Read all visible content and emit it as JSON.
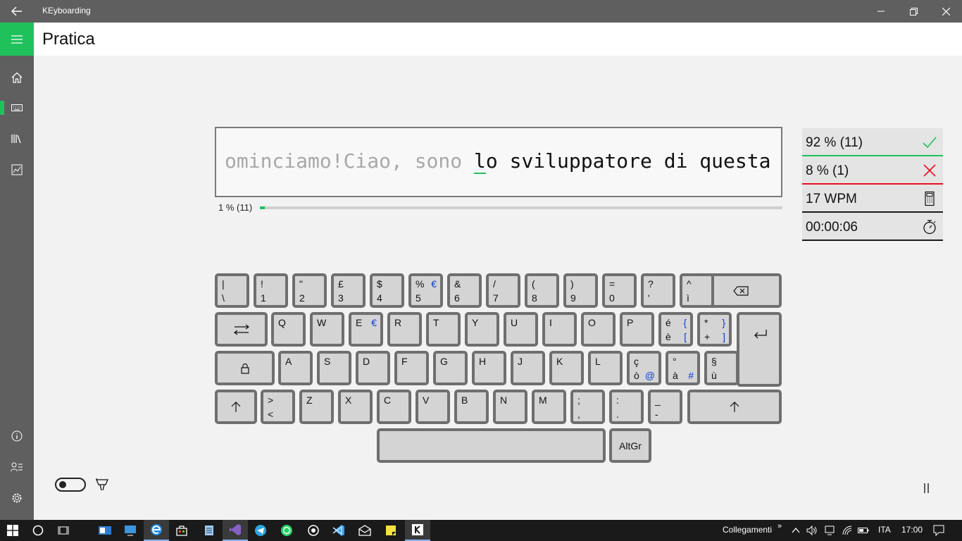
{
  "window": {
    "title": "KEyboarding"
  },
  "header": {
    "title": "Pratica"
  },
  "exercise": {
    "typed": "ominciamo!Ciao, sono ",
    "current": "l",
    "remaining": "o sviluppatore di questa app",
    "progress_text": "1 % (11)",
    "progress_fraction": 0.01
  },
  "stats": {
    "correct": "92 % (11)",
    "errors": "8 % (1)",
    "speed": "17 WPM",
    "time": "00:00:06"
  },
  "keyboard": {
    "row1": [
      {
        "top": "|",
        "bottom": "\\"
      },
      {
        "top": "!",
        "bottom": "1"
      },
      {
        "top": "\"",
        "bottom": "2"
      },
      {
        "top": "£",
        "bottom": "3"
      },
      {
        "top": "$",
        "bottom": "4"
      },
      {
        "top": "%",
        "bottom": "5",
        "alt_top": "€"
      },
      {
        "top": "&",
        "bottom": "6"
      },
      {
        "top": "/",
        "bottom": "7"
      },
      {
        "top": "(",
        "bottom": "8"
      },
      {
        "top": ")",
        "bottom": "9"
      },
      {
        "top": "=",
        "bottom": "0"
      },
      {
        "top": "?",
        "bottom": "'"
      },
      {
        "top": "^",
        "bottom": "ì"
      }
    ],
    "row2": [
      {
        "top": "Q"
      },
      {
        "top": "W"
      },
      {
        "top": "E",
        "alt_top": "€"
      },
      {
        "top": "R"
      },
      {
        "top": "T"
      },
      {
        "top": "Y"
      },
      {
        "top": "U"
      },
      {
        "top": "I"
      },
      {
        "top": "O"
      },
      {
        "top": "P"
      },
      {
        "top": "é",
        "bottom": "è",
        "alt_top": "{",
        "alt_bottom": "["
      },
      {
        "top": "*",
        "bottom": "+",
        "alt_top": "}",
        "alt_bottom": "]"
      }
    ],
    "row3": [
      {
        "top": "A"
      },
      {
        "top": "S"
      },
      {
        "top": "D"
      },
      {
        "top": "F"
      },
      {
        "top": "G"
      },
      {
        "top": "H"
      },
      {
        "top": "J"
      },
      {
        "top": "K"
      },
      {
        "top": "L"
      },
      {
        "top": "ç",
        "bottom": "ò",
        "alt_bottom": "@"
      },
      {
        "top": "°",
        "bottom": "à",
        "alt_bottom": "#"
      },
      {
        "top": "§",
        "bottom": "ù"
      }
    ],
    "row4": [
      {
        "top": ">",
        "bottom": "<"
      },
      {
        "top": "Z"
      },
      {
        "top": "X"
      },
      {
        "top": "C"
      },
      {
        "top": "V"
      },
      {
        "top": "B"
      },
      {
        "top": "N"
      },
      {
        "top": "M"
      },
      {
        "top": ";",
        "bottom": ","
      },
      {
        "top": ":",
        "bottom": "."
      },
      {
        "top": "_",
        "bottom": "-"
      }
    ],
    "altgr_label": "AltGr"
  },
  "taskbar": {
    "links_label": "Collegamenti",
    "language": "ITA",
    "clock": "17:00"
  },
  "colors": {
    "accent": "#1fc15b",
    "error": "#e81123",
    "alt_char": "#0a3fd6"
  }
}
